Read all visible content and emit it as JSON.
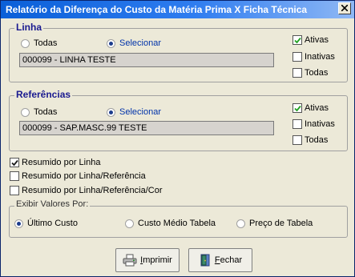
{
  "window": {
    "title": "Relatório da Diferença do Custo da Matéria Prima X Ficha Técnica"
  },
  "linha": {
    "title": "Linha",
    "radio_todas": "Todas",
    "radio_selecionar": "Selecionar",
    "selected_radio": "Selecionar",
    "value": "000099 - LINHA TESTE",
    "checks": [
      {
        "label": "Ativas",
        "checked": true
      },
      {
        "label": "Inativas",
        "checked": false
      },
      {
        "label": "Todas",
        "checked": false
      }
    ]
  },
  "referencias": {
    "title": "Referências",
    "radio_todas": "Todas",
    "radio_selecionar": "Selecionar",
    "selected_radio": "Selecionar",
    "value": "000099 - SAP.MASC.99 TESTE",
    "checks": [
      {
        "label": "Ativas",
        "checked": true
      },
      {
        "label": "Inativas",
        "checked": false
      },
      {
        "label": "Todas",
        "checked": false
      }
    ]
  },
  "options": [
    {
      "label": "Resumido por Linha",
      "checked": true
    },
    {
      "label": "Resumido por Linha/Referência",
      "checked": false
    },
    {
      "label": "Resumido por Linha/Referência/Cor",
      "checked": false
    }
  ],
  "exibir": {
    "title": "Exibir Valores Por:",
    "options": [
      "Último Custo",
      "Custo Médio Tabela",
      "Preço de Tabela"
    ],
    "selected": "Último Custo"
  },
  "buttons": {
    "imprimir": {
      "first": "I",
      "rest": "mprimir"
    },
    "fechar": {
      "first": "F",
      "rest": "echar"
    }
  }
}
